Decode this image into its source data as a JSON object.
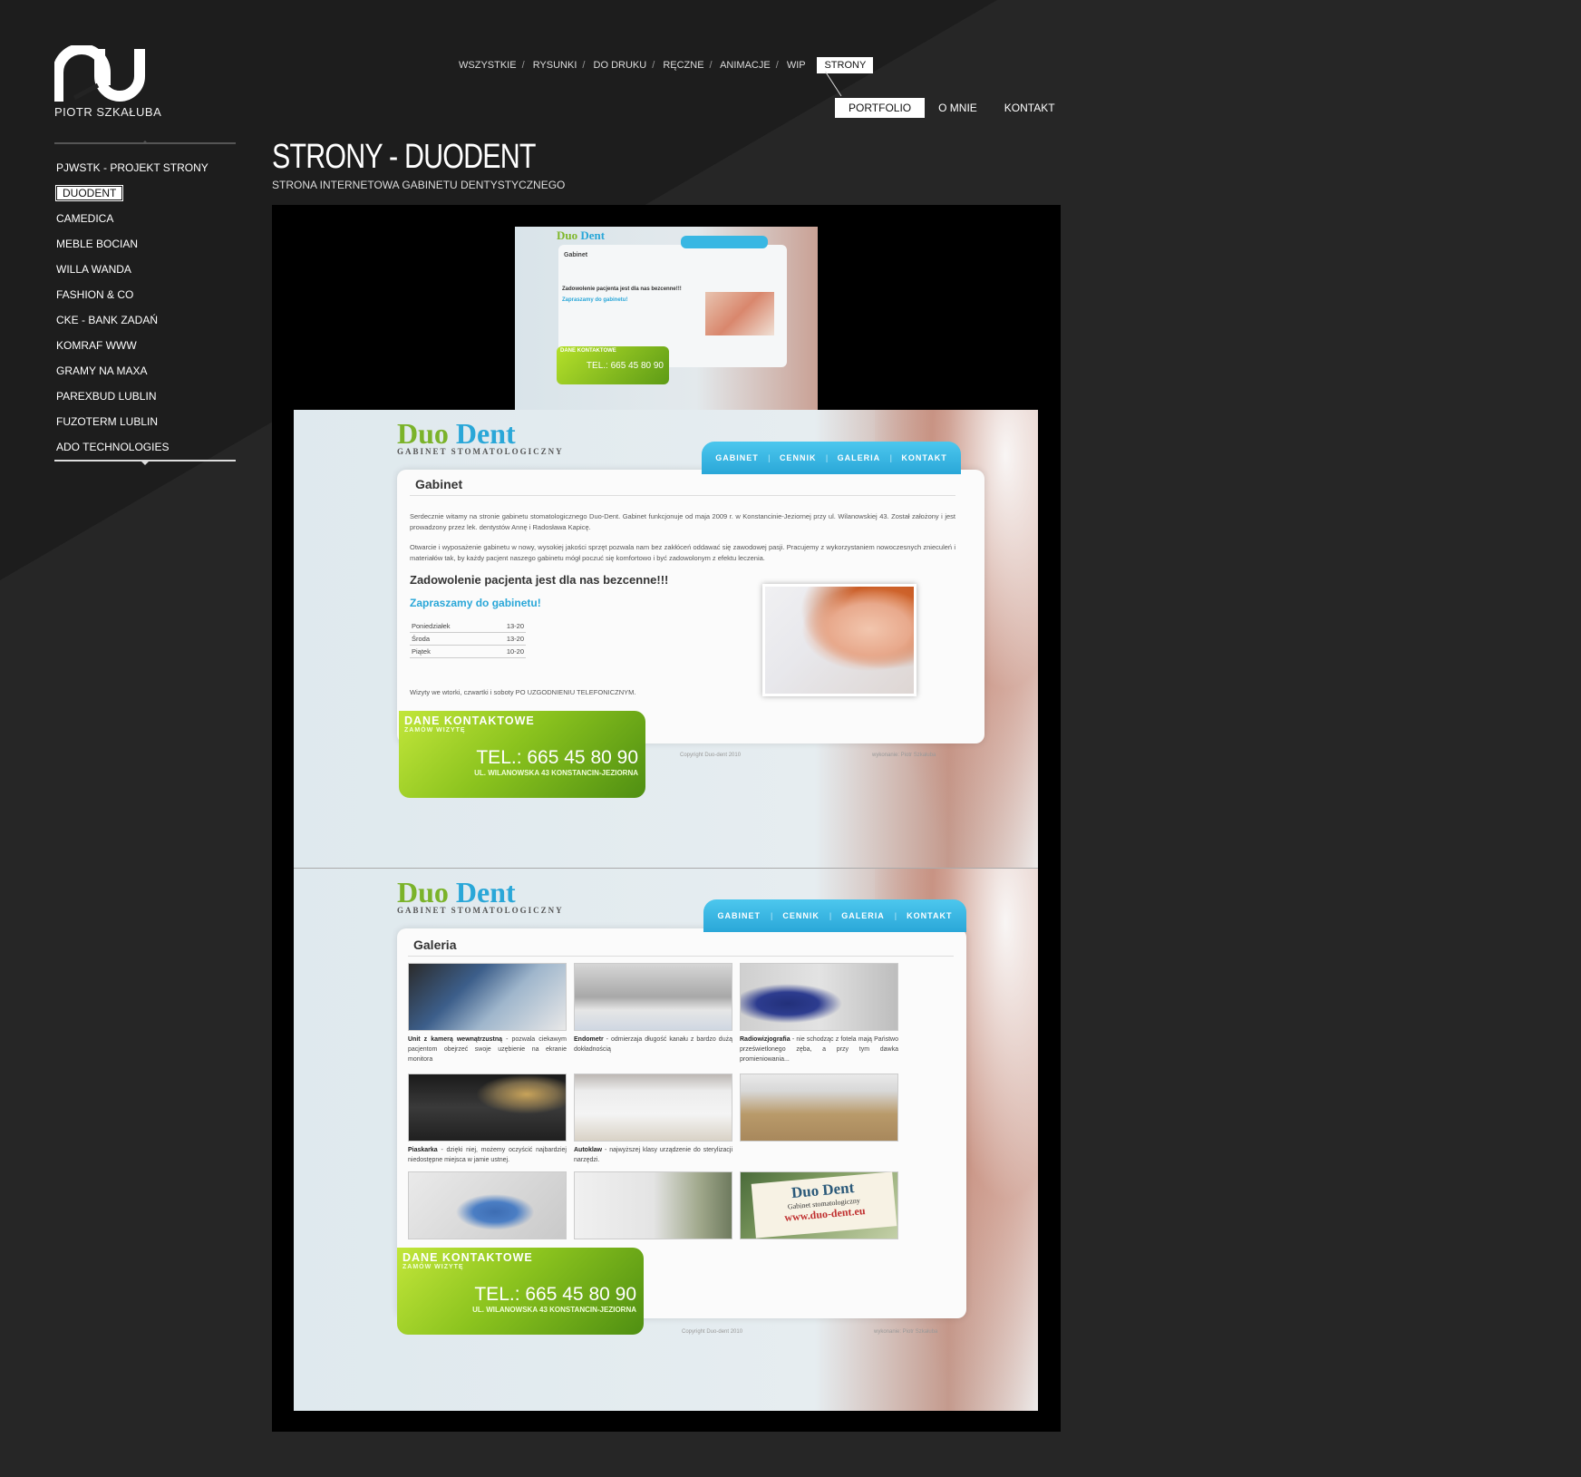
{
  "logo": {
    "name": "PIOTR SZKAŁUBA"
  },
  "filter": {
    "items": [
      "WSZYSTKIE",
      "RYSUNKI",
      "DO DRUKU",
      "RĘCZNE",
      "ANIMACJE",
      "WIP"
    ],
    "separator": "/",
    "active": "STRONY"
  },
  "mainnav": {
    "portfolio": "PORTFOLIO",
    "about": "O MNIE",
    "contact": "KONTAKT"
  },
  "sidebar": {
    "items": [
      "PJWSTK - PROJEKT STRONY",
      "DUODENT",
      "CAMEDICA",
      "MEBLE BOCIAN",
      "WILLA WANDA",
      "FASHION & CO",
      "CKE - BANK ZADAŃ",
      "KOMRAF WWW",
      "GRAMY NA MAXA",
      "PAREXBUD LUBLIN",
      "FUZOTERM LUBLIN",
      "ADO TECHNOLOGIES"
    ],
    "active_index": 1
  },
  "page": {
    "title": "STRONY - DUODENT",
    "subtitle": "STRONA INTERNETOWA GABINETU DENTYSTYCZNEGO"
  },
  "preview": {
    "brand_duo": "Duo",
    "brand_dent": "Dent",
    "brand_sub": "GABINET STOMATOLOGICZNY",
    "nav": [
      "GABINET",
      "CENNIK",
      "GALERIA",
      "KONTAKT"
    ],
    "mini": {
      "heading": "Gabinet",
      "line": "Zadowolenie pacjenta jest dla nas bezcenne!!!",
      "invite": "Zapraszamy do gabinetu!",
      "green_title": "DANE KONTAKTOWE",
      "tel": "TEL.: 665 45 80 90"
    },
    "page1": {
      "heading": "Gabinet",
      "p1": "Serdecznie witamy na stronie gabinetu stomatologicznego Duo-Dent. Gabinet funkcjonuje od maja 2009 r. w Konstancinie-Jeziornej przy ul. Wilanowskiej 43. Został założony i jest prowadzony przez lek. dentystów Annę i Radosława Kapicę.",
      "p2": "Otwarcie i wyposażenie gabinetu w nowy, wysokiej jakości sprzęt pozwala nam bez zakłóceń oddawać się zawodowej pasji. Pracujemy z wykorzystaniem nowoczesnych znieculeń i materiałów tak, by każdy pacjent naszego gabinetu mógł poczuć się komfortowo i być zadowolonym z efektu leczenia.",
      "big": "Zadowolenie pacjenta jest dla nas bezcenne!!!",
      "invite": "Zapraszamy do gabinetu!",
      "hours": [
        {
          "day": "Poniedziałek",
          "time": "13-20"
        },
        {
          "day": "Środa",
          "time": "13-20"
        },
        {
          "day": "Piątek",
          "time": "10-20"
        }
      ],
      "visits": "Wizyty we wtorki, czwartki i soboty PO UZGODNIENIU TELEFONICZNYM."
    },
    "page2": {
      "heading": "Galeria",
      "captions": [
        {
          "bold": "Unit z kamerą wewnątrzustną",
          "rest": " - pozwala ciekawym pacjentom obejrzeć swoje uzębienie na ekranie monitora"
        },
        {
          "bold": "Endometr",
          "rest": " - odmierzaja długość kanału z bardzo dużą dokładnością"
        },
        {
          "bold": "Radiowizjografia",
          "rest": " - nie schodząc z fotela mają Państwo prześwietlonego zęba, a przy tym dawka promieniowania..."
        },
        {
          "bold": "Piaskarka",
          "rest": " - dzięki niej, możemy oczyścić najbardziej niedostępne miejsca w jamie ustnej."
        },
        {
          "bold": "Autoklaw",
          "rest": " - najwyższej klasy urządzenie do sterylizacji narzędzi."
        },
        {
          "bold": "",
          "rest": ""
        }
      ],
      "sign": "Duo Dent",
      "sign2": "Gabinet stomatologiczny",
      "sign3": "www.duo-dent.eu"
    },
    "contact": {
      "title": "DANE KONTAKTOWE",
      "sub": "ZAMÓW WIZYTĘ",
      "tel": "TEL.: 665 45 80 90",
      "address": "UL. WILANOWSKA 43 KONSTANCIN-JEZIORNA"
    },
    "copyright": "Copyright Duo-dent 2010",
    "author": "wykonanie: Piotr Szkałuba"
  }
}
